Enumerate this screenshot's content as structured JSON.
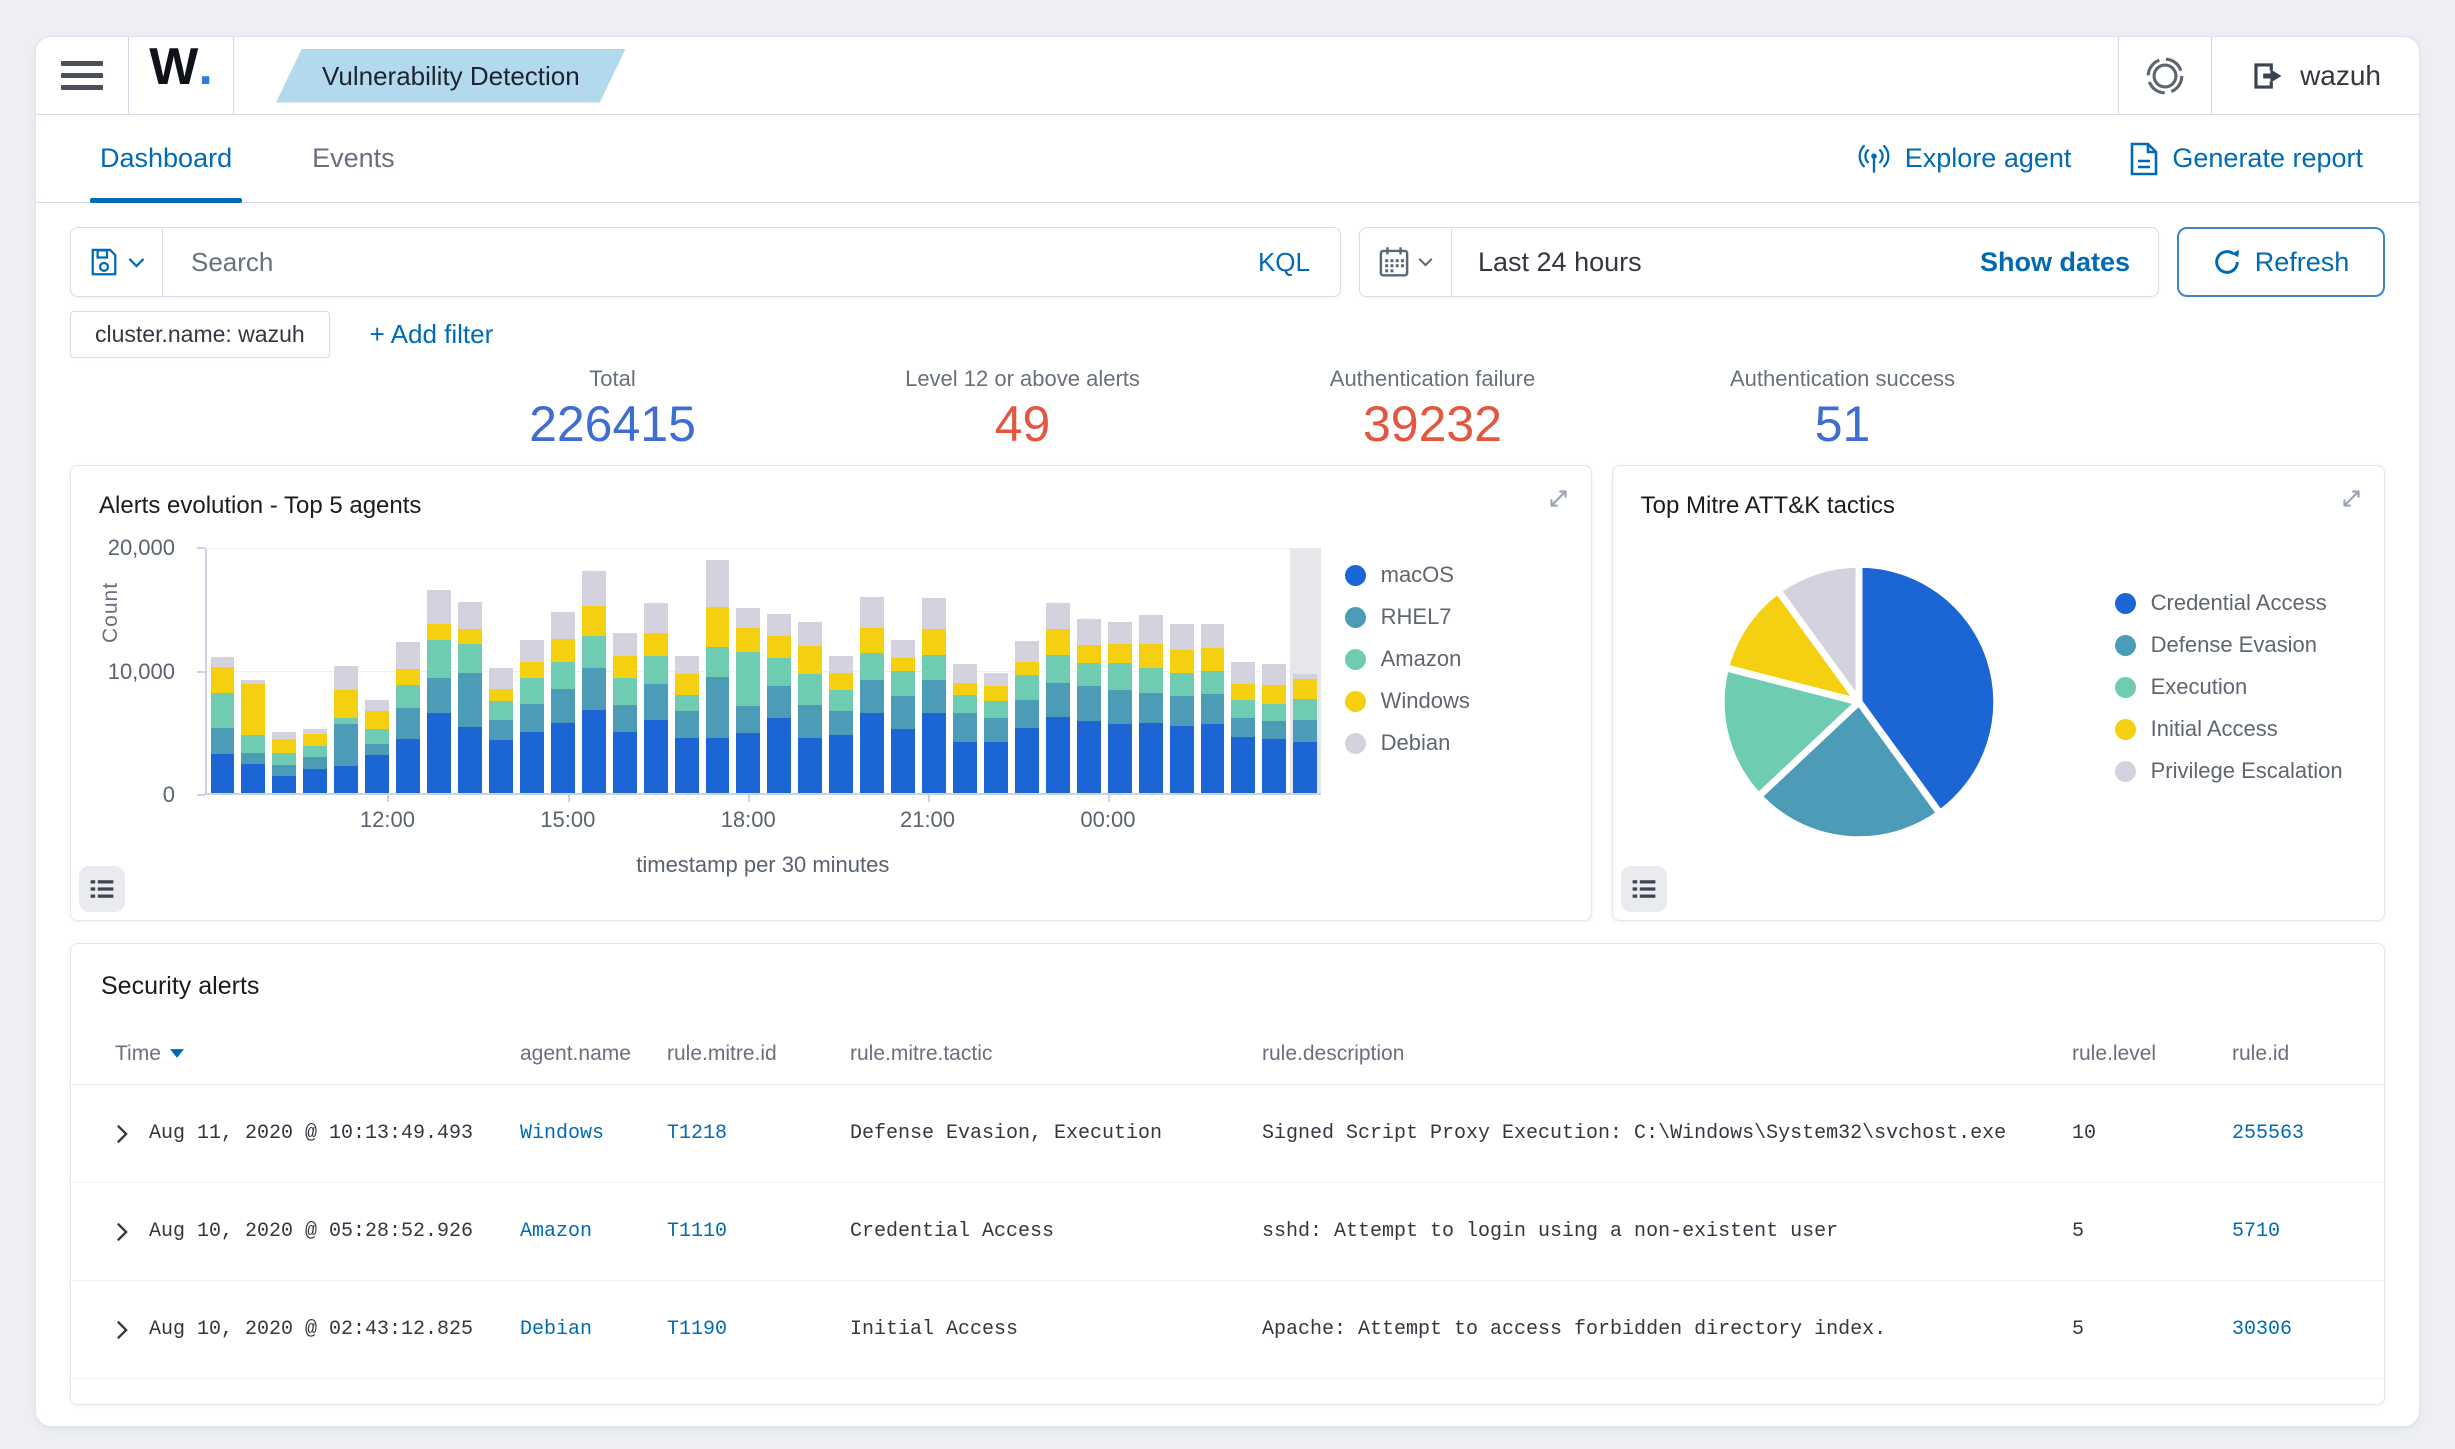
{
  "app": {
    "logo_w": "W",
    "logo_dot": ".",
    "breadcrumb": "Vulnerability Detection",
    "user_label": "wazuh"
  },
  "tabs": {
    "dashboard": "Dashboard",
    "events": "Events"
  },
  "actions": {
    "explore_agent": "Explore agent",
    "generate_report": "Generate report"
  },
  "search_bar": {
    "placeholder": "Search",
    "kql_label": "KQL",
    "time_range": "Last 24 hours",
    "show_dates_label": "Show dates",
    "refresh_label": "Refresh"
  },
  "filter_bar": {
    "filter_chip": "cluster.name: wazuh",
    "add_filter_label": "+ Add filter"
  },
  "stats": [
    {
      "label": "Total",
      "value": "226415",
      "color": "#3e6ed2"
    },
    {
      "label": "Level 12 or above alerts",
      "value": "49",
      "color": "#e2573e"
    },
    {
      "label": "Authentication failure",
      "value": "39232",
      "color": "#e2573e"
    },
    {
      "label": "Authentication success",
      "value": "51",
      "color": "#3e6ed2"
    }
  ],
  "icons": {
    "menu-icon": "hamburger three bars",
    "save-icon": "floppy outline",
    "chevron-down-icon": "v",
    "calendar-icon": "calendar grid",
    "refresh-icon": "circular arrow",
    "broadcast-icon": "((o)) antenna",
    "report-icon": "document with lines",
    "logout-icon": "exit arrow",
    "health-ring-icon": "double ring",
    "expand-icon": "diagonal resize arrows",
    "legend-list-icon": "bulleted list",
    "sort-desc-icon": "down triangle",
    "row-expand-icon": "chevron right"
  },
  "chart_data": [
    {
      "type": "bar",
      "stacked": true,
      "title": "Alerts evolution - Top 5 agents",
      "xlabel": "timestamp per 30 minutes",
      "ylabel": "Count",
      "ylim": [
        0,
        20000
      ],
      "yticks": [
        "0",
        "10,000",
        "20,000"
      ],
      "xticks": {
        "labels": [
          "12:00",
          "15:00",
          "18:00",
          "21:00",
          "00:00"
        ],
        "positions": [
          0.162,
          0.324,
          0.486,
          0.647,
          0.809
        ]
      },
      "grid": true,
      "legend_position": "right",
      "highlight_last_bucket": true,
      "series": [
        {
          "name": "macOS",
          "color": "#1c65d4",
          "values": [
            3200,
            2400,
            1400,
            2000,
            2200,
            3100,
            4400,
            6500,
            5400,
            4300,
            5000,
            5700,
            6800,
            5000,
            6000,
            4500,
            4500,
            4900,
            6100,
            4500,
            4700,
            6500,
            5200,
            6500,
            4200,
            4200,
            5300,
            6200,
            5900,
            5600,
            5700,
            5500,
            5600,
            4600,
            4400,
            4200
          ]
        },
        {
          "name": "RHEL7",
          "color": "#4c9cb7",
          "values": [
            2100,
            900,
            900,
            900,
            3400,
            900,
            2500,
            2900,
            4400,
            1700,
            2300,
            2800,
            3400,
            2200,
            2900,
            2200,
            5000,
            2200,
            2600,
            2700,
            2000,
            2700,
            2700,
            2700,
            2300,
            1900,
            2300,
            2800,
            2800,
            2800,
            2500,
            2400,
            2500,
            1500,
            1500,
            1800
          ]
        },
        {
          "name": "Amazon",
          "color": "#6dccb1",
          "values": [
            2900,
            1400,
            1000,
            900,
            500,
            1200,
            1900,
            3100,
            2400,
            1500,
            2100,
            2200,
            2600,
            2200,
            2300,
            1300,
            2400,
            4400,
            2300,
            2500,
            1700,
            2200,
            2100,
            2100,
            1500,
            1400,
            2000,
            2300,
            1900,
            2200,
            2000,
            1900,
            1900,
            1500,
            1400,
            1700
          ]
        },
        {
          "name": "Windows",
          "color": "#f5d010",
          "values": [
            2100,
            4200,
            1100,
            1000,
            2300,
            1500,
            1300,
            1300,
            1200,
            1000,
            1300,
            1900,
            2500,
            1800,
            1900,
            1700,
            3300,
            2000,
            1800,
            2300,
            1400,
            2100,
            1000,
            2100,
            1000,
            1200,
            1100,
            2100,
            1500,
            1600,
            2000,
            1900,
            1800,
            1300,
            1500,
            1600
          ]
        },
        {
          "name": "Debian",
          "color": "#d5d2e0",
          "values": [
            800,
            300,
            600,
            400,
            2000,
            900,
            2200,
            2800,
            2200,
            1700,
            1800,
            2200,
            2800,
            1900,
            2400,
            1500,
            3800,
            1600,
            1800,
            2000,
            1400,
            2500,
            1500,
            2500,
            1500,
            1100,
            1700,
            2100,
            2100,
            1800,
            2300,
            2100,
            2000,
            1800,
            1700,
            400
          ]
        }
      ]
    },
    {
      "type": "pie",
      "title": "Top Mitre ATT&K tactics",
      "labels": [
        "Credential Access",
        "Defense Evasion",
        "Execution",
        "Initial Access",
        "Privilege Escalation"
      ],
      "values": [
        40,
        23,
        16,
        11,
        10
      ],
      "colors": [
        "#1c65d4",
        "#4c9cb7",
        "#6dccb1",
        "#f5d010",
        "#d5d2e0"
      ],
      "legend_position": "right"
    }
  ],
  "table": {
    "title": "Security alerts",
    "sort_column": "Time",
    "columns": [
      "Time",
      "agent.name",
      "rule.mitre.id",
      "rule.mitre.tactic",
      "rule.description",
      "rule.level",
      "rule.id"
    ],
    "rows": [
      {
        "time": "Aug 11, 2020 @ 10:13:49.493",
        "agent": "Windows",
        "mitre_id": "T1218",
        "tactic": "Defense Evasion, Execution",
        "description": "Signed Script Proxy Execution: C:\\Windows\\System32\\svchost.exe",
        "level": "10",
        "rule_id": "255563"
      },
      {
        "time": "Aug 10, 2020 @ 05:28:52.926",
        "agent": "Amazon",
        "mitre_id": "T1110",
        "tactic": "Credential Access",
        "description": "sshd: Attempt to login using a non-existent user",
        "level": "5",
        "rule_id": "5710"
      },
      {
        "time": "Aug 10, 2020 @ 02:43:12.825",
        "agent": "Debian",
        "mitre_id": "T1190",
        "tactic": "Initial Access",
        "description": "Apache: Attempt to access forbidden directory index.",
        "level": "5",
        "rule_id": "30306"
      }
    ]
  },
  "theme": {
    "accent": "#006BB4",
    "metric_blue": "#3e6ed2",
    "metric_red": "#e2573e",
    "border": "#d3dae6"
  }
}
